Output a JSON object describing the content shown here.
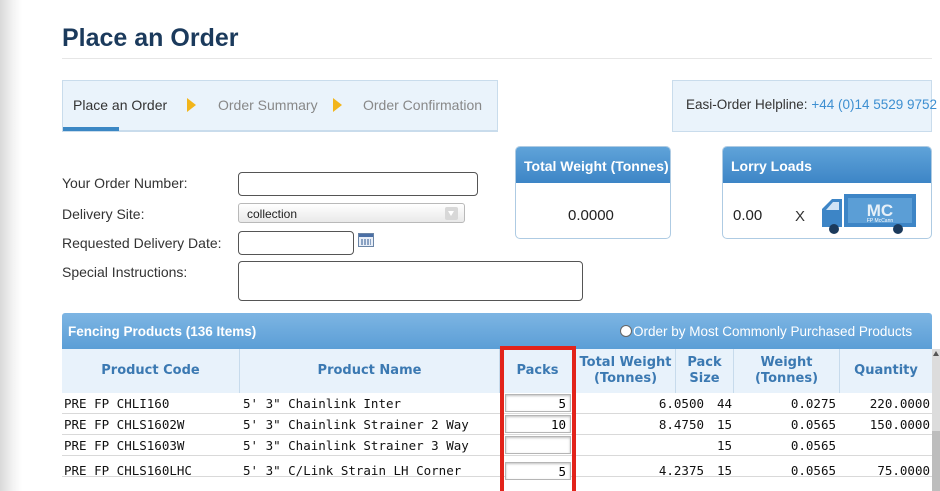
{
  "page_title": "Place an Order",
  "steps": [
    {
      "label": "Place an Order",
      "active": true
    },
    {
      "label": "Order Summary",
      "active": false
    },
    {
      "label": "Order Confirmation",
      "active": false
    }
  ],
  "helpline": {
    "label": "Easi-Order Helpline:",
    "phone": "+44 (0)14 5529 9752"
  },
  "form": {
    "order_number_label": "Your Order Number:",
    "order_number_value": "",
    "delivery_site_label": "Delivery Site:",
    "delivery_site_value": "collection",
    "delivery_date_label": "Requested Delivery Date:",
    "delivery_date_value": "",
    "special_instructions_label": "Special Instructions:",
    "special_instructions_value": ""
  },
  "total_weight": {
    "title": "Total Weight (Tonnes)",
    "value": "0.0000"
  },
  "lorry_loads": {
    "title": "Lorry Loads",
    "value": "0.00",
    "multiplier": "X",
    "logo_text": "MC",
    "logo_subtext": "FP McCann"
  },
  "table": {
    "title": "Fencing Products (136 Items)",
    "sort_option": "Order by Most Commonly Purchased Products",
    "columns": {
      "product_code": "Product Code",
      "product_name": "Product Name",
      "packs": "Packs",
      "total_weight_1": "Total Weight",
      "total_weight_2": "(Tonnes)",
      "pack_size_1": "Pack",
      "pack_size_2": "Size",
      "weight_1": "Weight",
      "weight_2": "(Tonnes)",
      "quantity": "Quantity"
    },
    "rows": [
      {
        "code": "PRE FP CHLI160",
        "name": "5' 3\" Chainlink Inter",
        "packs": "5",
        "total_weight": "6.0500",
        "pack_size": "44",
        "weight": "0.0275",
        "quantity": "220.0000"
      },
      {
        "code": "PRE FP CHLS1602W",
        "name": "5' 3\" Chainlink Strainer 2 Way",
        "packs": "10",
        "total_weight": "8.4750",
        "pack_size": "15",
        "weight": "0.0565",
        "quantity": "150.0000"
      },
      {
        "code": "PRE FP CHLS1603W",
        "name": "5' 3\" Chainlink Strainer 3 Way",
        "packs": "",
        "total_weight": "",
        "pack_size": "15",
        "weight": "0.0565",
        "quantity": ""
      },
      {
        "code": "PRE FP CHLS160LHC",
        "name": "5' 3\" C/Link Strain LH Corner",
        "packs": "5",
        "total_weight": "4.2375",
        "pack_size": "15",
        "weight": "0.0565",
        "quantity": "75.0000"
      }
    ]
  },
  "colors": {
    "accent": "#3d85c6",
    "title": "#1b3a5c",
    "highlight": "#e2231a",
    "step_arrow": "#f2b51b",
    "link": "#3d8fd1"
  }
}
